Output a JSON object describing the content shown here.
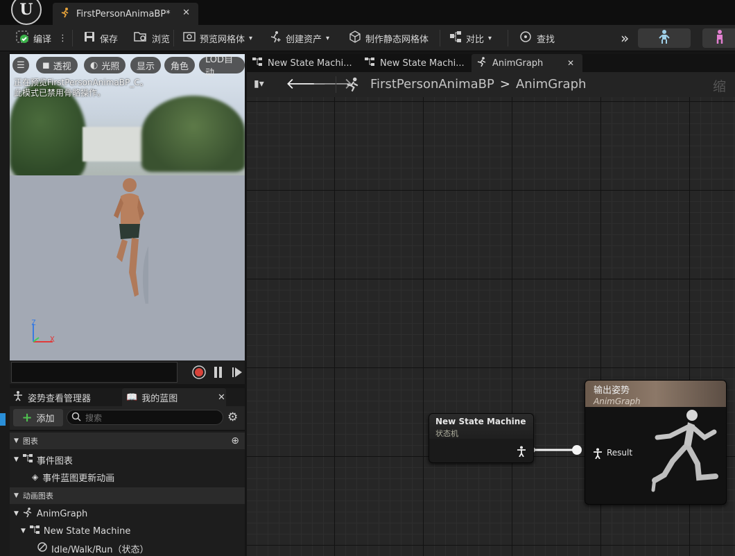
{
  "window": {
    "logo_text": "U",
    "doc_tab_title": "FirstPersonAnimaBP*"
  },
  "toolbar": {
    "compile_label": "编译",
    "save_label": "保存",
    "browse_label": "浏览",
    "preview_mesh_label": "预览网格体",
    "create_asset_label": "创建资产",
    "make_static_mesh_label": "制作静态网格体",
    "diff_label": "对比",
    "find_label": "查找"
  },
  "viewport": {
    "perspective_label": "透视",
    "lighting_label": "光照",
    "show_label": "显示",
    "character_label": "角色",
    "lod_label": "LOD自动",
    "note_line1": "正在预览FirstPersonAnimaBP_C。",
    "note_line2": "此模式已禁用骨骼操作。",
    "axis_z": "Z",
    "axis_x": "X"
  },
  "left_panel": {
    "tab_pose_watch": "姿势查看管理器",
    "tab_my_blueprint": "我的蓝图",
    "add_label": "添加",
    "search_placeholder": "搜索",
    "section_graphs": "图表",
    "event_graph": "事件图表",
    "event_update_anim": "事件蓝图更新动画",
    "section_anim_graphs": "动画图表",
    "anim_graph": "AnimGraph",
    "state_machine": "New State Machine",
    "state_item": "Idle/Walk/Run（状态）"
  },
  "graph_tabs": [
    {
      "label": "New State Machi..."
    },
    {
      "label": "New State Machi..."
    },
    {
      "label": "AnimGraph"
    }
  ],
  "breadcrumb": {
    "root": "FirstPersonAnimaBP",
    "separator": ">",
    "current": "AnimGraph",
    "zoom_label": "缩放"
  },
  "nodes": {
    "state_machine_title": "New State Machine",
    "state_machine_subtitle": "状态机",
    "output_pose_title": "输出姿势",
    "output_pose_subtitle": "AnimGraph",
    "result_pin_label": "Result"
  },
  "colors": {
    "graph_bg": "#262626",
    "accent_record": "#d9433a",
    "add_green": "#4fc14f",
    "output_header": "#8c7868"
  }
}
